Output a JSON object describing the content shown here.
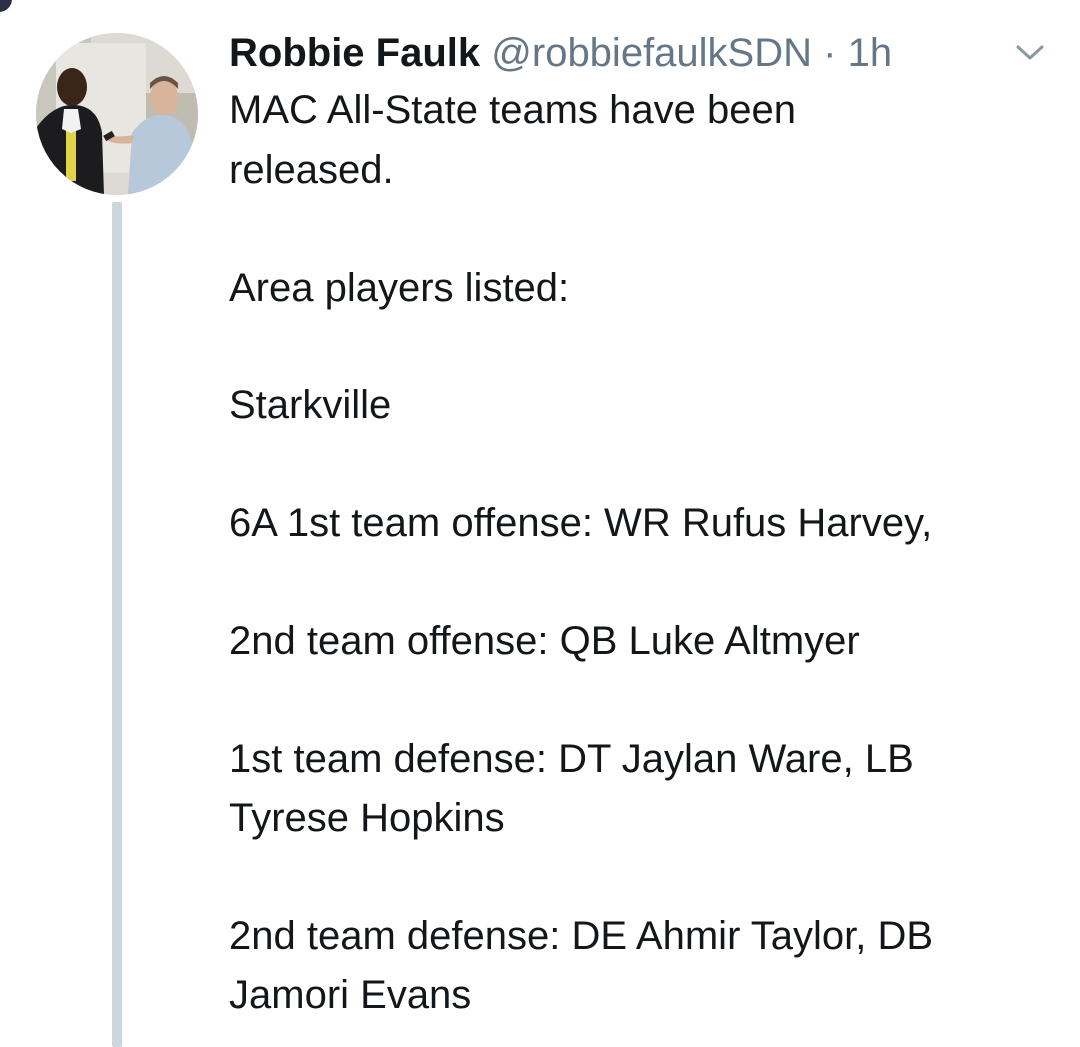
{
  "tweet": {
    "author": {
      "display_name": "Robbie Faulk",
      "handle": "@robbiefaulkSDN",
      "separator": "·",
      "timestamp": "1h"
    },
    "icons": {
      "avatar": "profile-photo",
      "menu": "chevron-down-icon"
    },
    "body_lines": [
      "MAC All-State teams have been",
      "released.",
      "Area players listed:",
      "Starkville",
      "6A 1st team offense: WR Rufus Harvey,",
      "2nd team offense: QB Luke Altmyer",
      "1st team defense: DT Jaylan Ware, LB",
      "Tyrese Hopkins",
      "2nd team defense: DE Ahmir Taylor, DB",
      "Jamori Evans"
    ]
  },
  "colors": {
    "text": "#14171a",
    "secondary_text": "#657786",
    "thread_line": "#ccd6dd",
    "background": "#ffffff"
  }
}
